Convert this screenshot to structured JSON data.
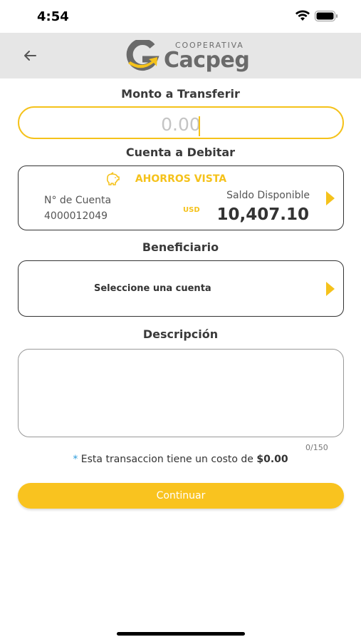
{
  "status_bar": {
    "time": "4:54"
  },
  "header": {
    "logo_top": "COOPERATIVA",
    "logo_name": "Cacpeg",
    "back_icon": "arrow-left-icon"
  },
  "amount": {
    "label": "Monto a Transferir",
    "placeholder": "0.00"
  },
  "debit": {
    "label": "Cuenta a Debitar",
    "account_type": "AHORROS VISTA",
    "account_number_label": "N° de Cuenta",
    "account_number": "4000012049",
    "balance_label": "Saldo Disponible",
    "currency": "USD",
    "balance": "10,407.10"
  },
  "beneficiary": {
    "label": "Beneficiario",
    "placeholder": "Seleccione una cuenta"
  },
  "description": {
    "label": "Descripción",
    "counter": "0/150"
  },
  "cost_note": {
    "asterisk": "*",
    "text": " Esta transaccion tiene un costo de ",
    "amount": "$0.00"
  },
  "continue_button": {
    "label": "Continuar"
  },
  "colors": {
    "accent": "#f5c21b",
    "header_bg": "#e6e6e6"
  }
}
